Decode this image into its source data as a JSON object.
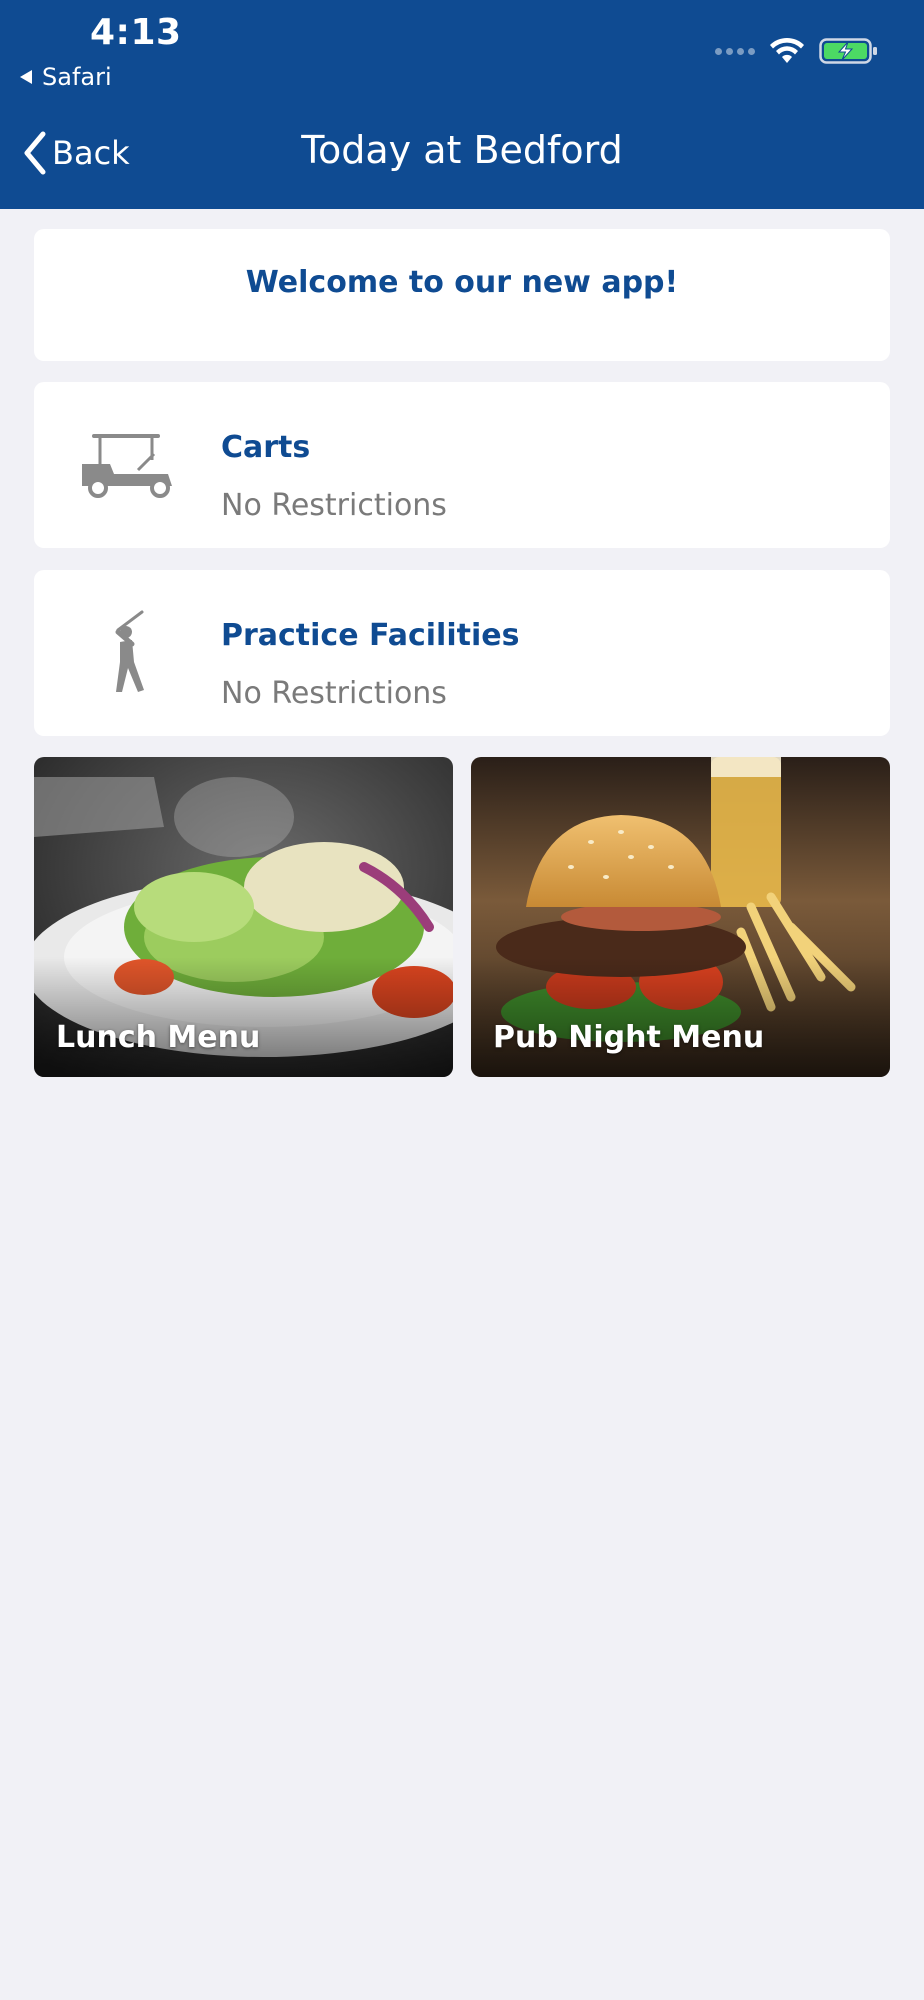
{
  "status_bar": {
    "time": "4:13",
    "back_app": "Safari",
    "icons": [
      "signal-icon",
      "wifi-icon",
      "battery-charging-icon"
    ]
  },
  "nav": {
    "back_label": "Back",
    "title": "Today at Bedford"
  },
  "welcome": {
    "text": "Welcome to our new app!"
  },
  "conditions": [
    {
      "title": "Carts",
      "status": "No Restrictions",
      "icon": "golf-cart-icon"
    },
    {
      "title": "Practice Facilities",
      "status": "No Restrictions",
      "icon": "golfer-icon"
    }
  ],
  "menus": [
    {
      "label": "Lunch Menu",
      "image": "salad-photo"
    },
    {
      "label": "Pub Night Menu",
      "image": "burger-photo"
    }
  ],
  "colors": {
    "header": "#0f4b92",
    "accent_text": "#0f4b92",
    "secondary_text": "#7a7a7a",
    "background": "#f1f1f6",
    "battery": "#4cd964"
  }
}
